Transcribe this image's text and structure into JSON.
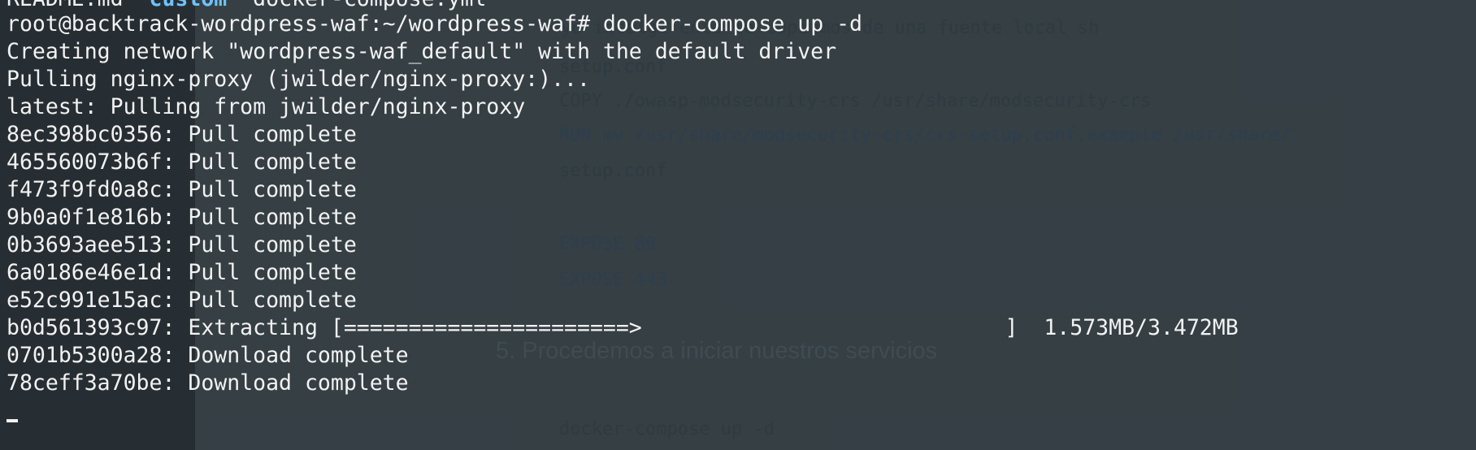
{
  "terminal": {
    "top_partial": {
      "file1": "README.md",
      "dir": "custom",
      "file2": "docker-compose.yml"
    },
    "prompt": "root@backtrack-wordpress-waf:~/wordpress-waf#",
    "command": "docker-compose up -d",
    "lines": [
      "Creating network \"wordpress-waf_default\" with the default driver",
      "Pulling nginx-proxy (jwilder/nginx-proxy:)...",
      "latest: Pulling from jwilder/nginx-proxy",
      "8ec398bc0356: Pull complete",
      "465560073b6f: Pull complete",
      "f473f9fd0a8c: Pull complete",
      "9b0a0f1e816b: Pull complete",
      "0b3693aee513: Pull complete",
      "6a0186e46e1d: Pull complete",
      "e52c991e15ac: Pull complete",
      "b0d561393c97: Extracting [======================>                            ]  1.573MB/3.472MB",
      "0701b5300a28: Download complete",
      "78ceff3a70be: Download complete"
    ]
  },
  "background_doc": {
    "lines": [
      "yo intelgi ente lo copiamos de una fuente local sh",
      "setup.conf",
      "COPY ./owasp-modsecurity-crs /usr/share/modsecurity-crs",
      "RUN mv /usr/share/modsecurity-crs/crs-setup.conf.example /usr/share/",
      "setup.conf",
      "EXPOSE 80",
      "EXPOSE 443",
      "docker-compose up -d"
    ],
    "heading": "5.  Procedemos a iniciar nuestros servicios"
  }
}
